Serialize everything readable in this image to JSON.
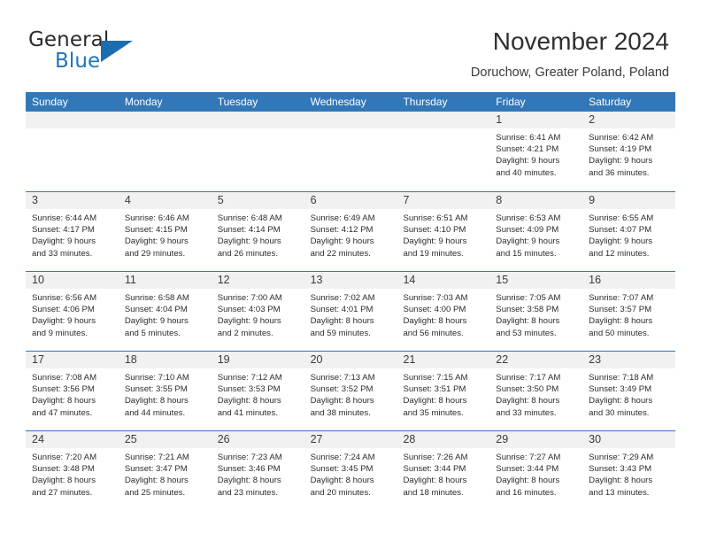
{
  "brand": {
    "word_one": "General",
    "word_two": "Blue",
    "logo_icon": "triangle-logo-icon",
    "accent_color": "#1b75bc"
  },
  "header": {
    "title": "November 2024",
    "subtitle": "Doruchow, Greater Poland, Poland"
  },
  "calendar": {
    "header_color": "#3277b8",
    "weekdays": [
      "Sunday",
      "Monday",
      "Tuesday",
      "Wednesday",
      "Thursday",
      "Friday",
      "Saturday"
    ],
    "weeks": [
      [
        {
          "day": "",
          "sunrise": "",
          "sunset": "",
          "daylight_line1": "",
          "daylight_line2": ""
        },
        {
          "day": "",
          "sunrise": "",
          "sunset": "",
          "daylight_line1": "",
          "daylight_line2": ""
        },
        {
          "day": "",
          "sunrise": "",
          "sunset": "",
          "daylight_line1": "",
          "daylight_line2": ""
        },
        {
          "day": "",
          "sunrise": "",
          "sunset": "",
          "daylight_line1": "",
          "daylight_line2": ""
        },
        {
          "day": "",
          "sunrise": "",
          "sunset": "",
          "daylight_line1": "",
          "daylight_line2": ""
        },
        {
          "day": "1",
          "sunrise": "Sunrise: 6:41 AM",
          "sunset": "Sunset: 4:21 PM",
          "daylight_line1": "Daylight: 9 hours",
          "daylight_line2": "and 40 minutes."
        },
        {
          "day": "2",
          "sunrise": "Sunrise: 6:42 AM",
          "sunset": "Sunset: 4:19 PM",
          "daylight_line1": "Daylight: 9 hours",
          "daylight_line2": "and 36 minutes."
        }
      ],
      [
        {
          "day": "3",
          "sunrise": "Sunrise: 6:44 AM",
          "sunset": "Sunset: 4:17 PM",
          "daylight_line1": "Daylight: 9 hours",
          "daylight_line2": "and 33 minutes."
        },
        {
          "day": "4",
          "sunrise": "Sunrise: 6:46 AM",
          "sunset": "Sunset: 4:15 PM",
          "daylight_line1": "Daylight: 9 hours",
          "daylight_line2": "and 29 minutes."
        },
        {
          "day": "5",
          "sunrise": "Sunrise: 6:48 AM",
          "sunset": "Sunset: 4:14 PM",
          "daylight_line1": "Daylight: 9 hours",
          "daylight_line2": "and 26 minutes."
        },
        {
          "day": "6",
          "sunrise": "Sunrise: 6:49 AM",
          "sunset": "Sunset: 4:12 PM",
          "daylight_line1": "Daylight: 9 hours",
          "daylight_line2": "and 22 minutes."
        },
        {
          "day": "7",
          "sunrise": "Sunrise: 6:51 AM",
          "sunset": "Sunset: 4:10 PM",
          "daylight_line1": "Daylight: 9 hours",
          "daylight_line2": "and 19 minutes."
        },
        {
          "day": "8",
          "sunrise": "Sunrise: 6:53 AM",
          "sunset": "Sunset: 4:09 PM",
          "daylight_line1": "Daylight: 9 hours",
          "daylight_line2": "and 15 minutes."
        },
        {
          "day": "9",
          "sunrise": "Sunrise: 6:55 AM",
          "sunset": "Sunset: 4:07 PM",
          "daylight_line1": "Daylight: 9 hours",
          "daylight_line2": "and 12 minutes."
        }
      ],
      [
        {
          "day": "10",
          "sunrise": "Sunrise: 6:56 AM",
          "sunset": "Sunset: 4:06 PM",
          "daylight_line1": "Daylight: 9 hours",
          "daylight_line2": "and 9 minutes."
        },
        {
          "day": "11",
          "sunrise": "Sunrise: 6:58 AM",
          "sunset": "Sunset: 4:04 PM",
          "daylight_line1": "Daylight: 9 hours",
          "daylight_line2": "and 5 minutes."
        },
        {
          "day": "12",
          "sunrise": "Sunrise: 7:00 AM",
          "sunset": "Sunset: 4:03 PM",
          "daylight_line1": "Daylight: 9 hours",
          "daylight_line2": "and 2 minutes."
        },
        {
          "day": "13",
          "sunrise": "Sunrise: 7:02 AM",
          "sunset": "Sunset: 4:01 PM",
          "daylight_line1": "Daylight: 8 hours",
          "daylight_line2": "and 59 minutes."
        },
        {
          "day": "14",
          "sunrise": "Sunrise: 7:03 AM",
          "sunset": "Sunset: 4:00 PM",
          "daylight_line1": "Daylight: 8 hours",
          "daylight_line2": "and 56 minutes."
        },
        {
          "day": "15",
          "sunrise": "Sunrise: 7:05 AM",
          "sunset": "Sunset: 3:58 PM",
          "daylight_line1": "Daylight: 8 hours",
          "daylight_line2": "and 53 minutes."
        },
        {
          "day": "16",
          "sunrise": "Sunrise: 7:07 AM",
          "sunset": "Sunset: 3:57 PM",
          "daylight_line1": "Daylight: 8 hours",
          "daylight_line2": "and 50 minutes."
        }
      ],
      [
        {
          "day": "17",
          "sunrise": "Sunrise: 7:08 AM",
          "sunset": "Sunset: 3:56 PM",
          "daylight_line1": "Daylight: 8 hours",
          "daylight_line2": "and 47 minutes."
        },
        {
          "day": "18",
          "sunrise": "Sunrise: 7:10 AM",
          "sunset": "Sunset: 3:55 PM",
          "daylight_line1": "Daylight: 8 hours",
          "daylight_line2": "and 44 minutes."
        },
        {
          "day": "19",
          "sunrise": "Sunrise: 7:12 AM",
          "sunset": "Sunset: 3:53 PM",
          "daylight_line1": "Daylight: 8 hours",
          "daylight_line2": "and 41 minutes."
        },
        {
          "day": "20",
          "sunrise": "Sunrise: 7:13 AM",
          "sunset": "Sunset: 3:52 PM",
          "daylight_line1": "Daylight: 8 hours",
          "daylight_line2": "and 38 minutes."
        },
        {
          "day": "21",
          "sunrise": "Sunrise: 7:15 AM",
          "sunset": "Sunset: 3:51 PM",
          "daylight_line1": "Daylight: 8 hours",
          "daylight_line2": "and 35 minutes."
        },
        {
          "day": "22",
          "sunrise": "Sunrise: 7:17 AM",
          "sunset": "Sunset: 3:50 PM",
          "daylight_line1": "Daylight: 8 hours",
          "daylight_line2": "and 33 minutes."
        },
        {
          "day": "23",
          "sunrise": "Sunrise: 7:18 AM",
          "sunset": "Sunset: 3:49 PM",
          "daylight_line1": "Daylight: 8 hours",
          "daylight_line2": "and 30 minutes."
        }
      ],
      [
        {
          "day": "24",
          "sunrise": "Sunrise: 7:20 AM",
          "sunset": "Sunset: 3:48 PM",
          "daylight_line1": "Daylight: 8 hours",
          "daylight_line2": "and 27 minutes."
        },
        {
          "day": "25",
          "sunrise": "Sunrise: 7:21 AM",
          "sunset": "Sunset: 3:47 PM",
          "daylight_line1": "Daylight: 8 hours",
          "daylight_line2": "and 25 minutes."
        },
        {
          "day": "26",
          "sunrise": "Sunrise: 7:23 AM",
          "sunset": "Sunset: 3:46 PM",
          "daylight_line1": "Daylight: 8 hours",
          "daylight_line2": "and 23 minutes."
        },
        {
          "day": "27",
          "sunrise": "Sunrise: 7:24 AM",
          "sunset": "Sunset: 3:45 PM",
          "daylight_line1": "Daylight: 8 hours",
          "daylight_line2": "and 20 minutes."
        },
        {
          "day": "28",
          "sunrise": "Sunrise: 7:26 AM",
          "sunset": "Sunset: 3:44 PM",
          "daylight_line1": "Daylight: 8 hours",
          "daylight_line2": "and 18 minutes."
        },
        {
          "day": "29",
          "sunrise": "Sunrise: 7:27 AM",
          "sunset": "Sunset: 3:44 PM",
          "daylight_line1": "Daylight: 8 hours",
          "daylight_line2": "and 16 minutes."
        },
        {
          "day": "30",
          "sunrise": "Sunrise: 7:29 AM",
          "sunset": "Sunset: 3:43 PM",
          "daylight_line1": "Daylight: 8 hours",
          "daylight_line2": "and 13 minutes."
        }
      ]
    ]
  }
}
